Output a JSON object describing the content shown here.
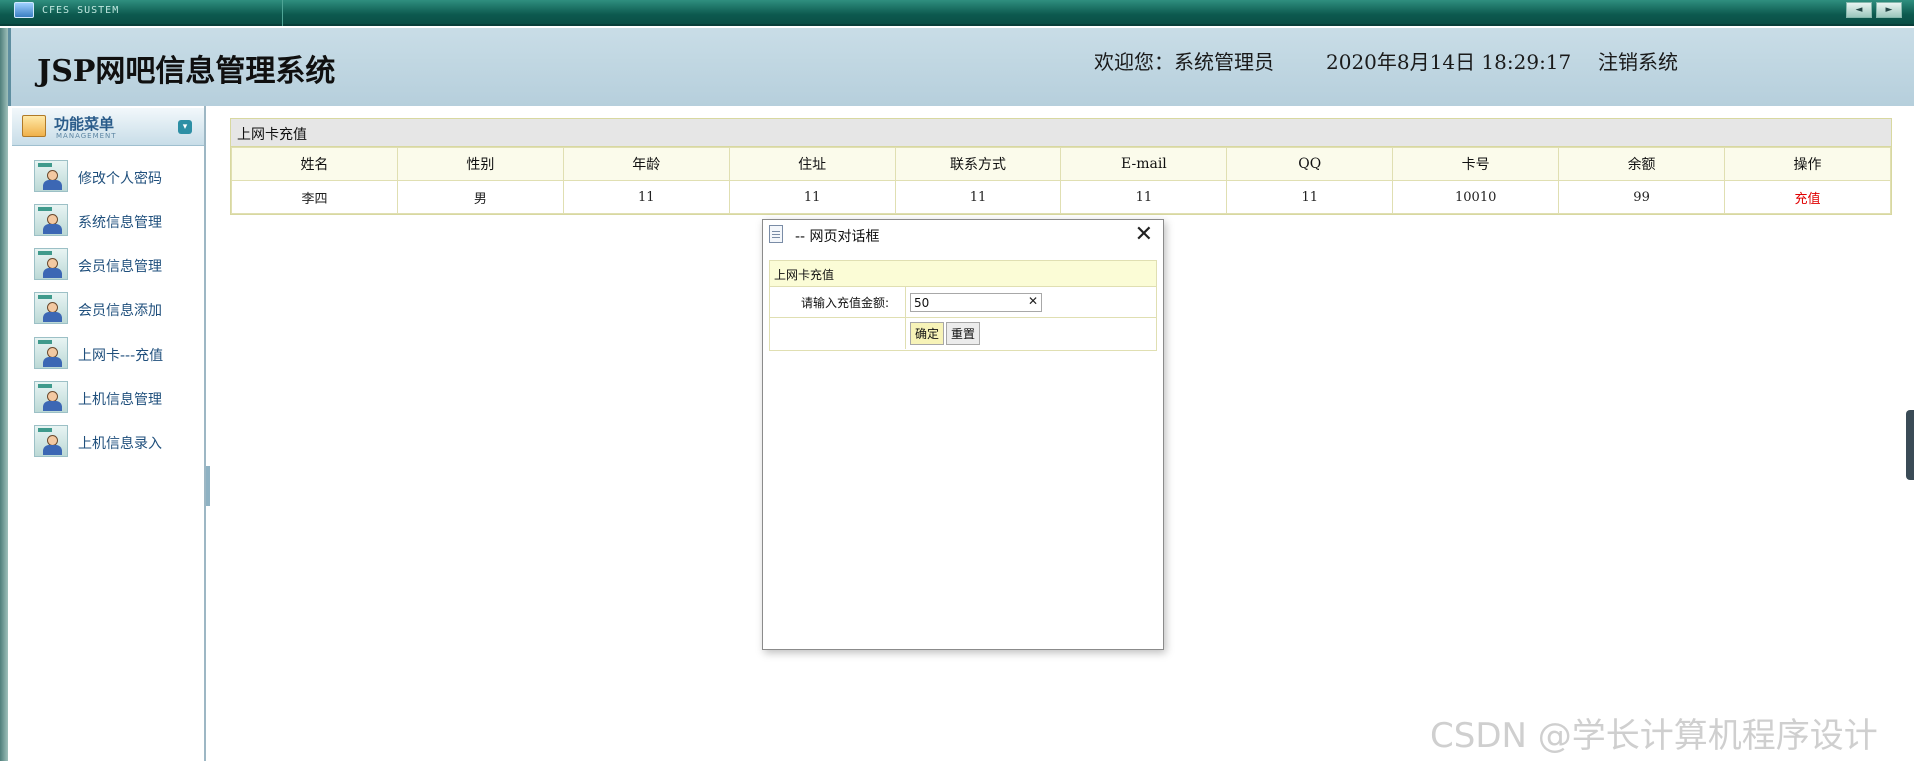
{
  "window": {
    "app_title": "CFES SUSTEM",
    "nav_left": "◄",
    "nav_right": "►"
  },
  "header": {
    "title": "JSP网吧信息管理系统",
    "welcome": "欢迎您：系统管理员",
    "datetime": "2020年8月14日  18:29:17",
    "logout": "注销系统"
  },
  "sidebar": {
    "menu_title": "功能菜单",
    "menu_subtitle": "MANAGEMENT",
    "items": [
      {
        "label": "修改个人密码"
      },
      {
        "label": "系统信息管理"
      },
      {
        "label": "会员信息管理"
      },
      {
        "label": "会员信息添加"
      },
      {
        "label": "上网卡---充值"
      },
      {
        "label": "上机信息管理"
      },
      {
        "label": "上机信息录入"
      }
    ]
  },
  "main": {
    "panel_title": "上网卡充值",
    "columns": [
      "姓名",
      "性别",
      "年龄",
      "住址",
      "联系方式",
      "E-mail",
      "QQ",
      "卡号",
      "余额",
      "操作"
    ],
    "rows": [
      {
        "name": "李四",
        "gender": "男",
        "age": "11",
        "address": "11",
        "contact": "11",
        "email": "11",
        "qq": "11",
        "card_no": "10010",
        "balance": "99",
        "action": "充值"
      }
    ]
  },
  "dialog": {
    "title": "-- 网页对话框",
    "close": "✕",
    "form_title": "上网卡充值",
    "amount_label": "请输入充值金额:",
    "amount_value": "50",
    "clear_glyph": "✕",
    "ok_label": "确定",
    "reset_label": "重置"
  },
  "watermark": "CSDN @学长计算机程序设计"
}
